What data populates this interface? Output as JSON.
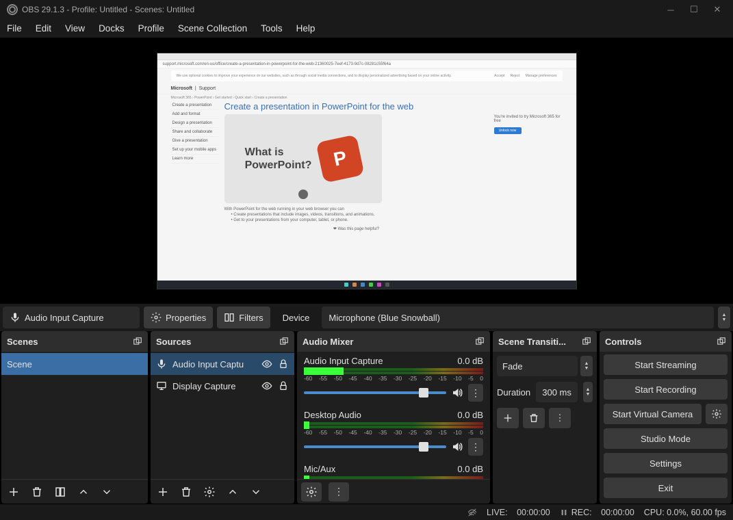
{
  "window": {
    "title": "OBS 29.1.3 - Profile: Untitled - Scenes: Untitled"
  },
  "menu": [
    "File",
    "Edit",
    "View",
    "Docks",
    "Profile",
    "Scene Collection",
    "Tools",
    "Help"
  ],
  "preview": {
    "url": "support.microsoft.com/en-us/office/create-a-presentation-in-powerpoint-for-the-web-21360025-7eef-4173-9d7c-08281c55f64a",
    "notice": "We use optional cookies to improve your experience on our websites, such as through social media connections, and to display personalized advertising based on your online activity.",
    "header_brand": "Microsoft",
    "header_sec": "Support",
    "crumbs": "Microsoft 365 › PowerPoint › Get started › Quick start › Create a presentation",
    "side_items": [
      "Create a presentation",
      "Add and format",
      "Design a presentation",
      "Share and collaborate",
      "Give a presentation",
      "Set up your mobile apps",
      "Learn more"
    ],
    "h1": "Create a presentation in PowerPoint for the web",
    "thumb_text1": "What is",
    "thumb_text2": "PowerPoint?",
    "right_h": "You're invited to try Microsoft 365 for free",
    "para0": "With PowerPoint for the web running in your web browser you can",
    "para1": "Create presentations that include images, videos, transitions, and animations.",
    "para2": "Get to your presentations from your computer, tablet, or phone.",
    "thanks": "Was this page helpful?"
  },
  "toolbar": {
    "source_label": "Audio Input Capture",
    "properties": "Properties",
    "filters": "Filters",
    "device_label": "Device",
    "device_value": "Microphone (Blue Snowball)"
  },
  "panels": {
    "scenes": {
      "title": "Scenes",
      "items": [
        "Scene"
      ]
    },
    "sources": {
      "title": "Sources",
      "items": [
        {
          "label": "Audio Input Captu",
          "icon": "mic",
          "selected": true,
          "locked": true,
          "visible": true
        },
        {
          "label": "Display Capture",
          "icon": "monitor",
          "selected": false,
          "locked": true,
          "visible": true
        }
      ]
    },
    "mixer": {
      "title": "Audio Mixer",
      "channels": [
        {
          "name": "Audio Input Capture",
          "db": "0.0 dB",
          "slider": true
        },
        {
          "name": "Desktop Audio",
          "db": "0.0 dB",
          "slider": true
        },
        {
          "name": "Mic/Aux",
          "db": "0.0 dB",
          "slider": false
        }
      ],
      "ticks": [
        "-60",
        "-55",
        "-50",
        "-45",
        "-40",
        "-35",
        "-30",
        "-25",
        "-20",
        "-15",
        "-10",
        "-5",
        "0"
      ]
    },
    "transitions": {
      "title": "Scene Transiti...",
      "select": "Fade",
      "duration_label": "Duration",
      "duration_value": "300 ms"
    },
    "controls": {
      "title": "Controls",
      "buttons": {
        "stream": "Start Streaming",
        "record": "Start Recording",
        "vcam": "Start Virtual Camera",
        "studio": "Studio Mode",
        "settings": "Settings",
        "exit": "Exit"
      }
    }
  },
  "status": {
    "live_label": "LIVE:",
    "live_time": "00:00:00",
    "rec_label": "REC:",
    "rec_time": "00:00:00",
    "cpu": "CPU: 0.0%, 60.00 fps"
  }
}
